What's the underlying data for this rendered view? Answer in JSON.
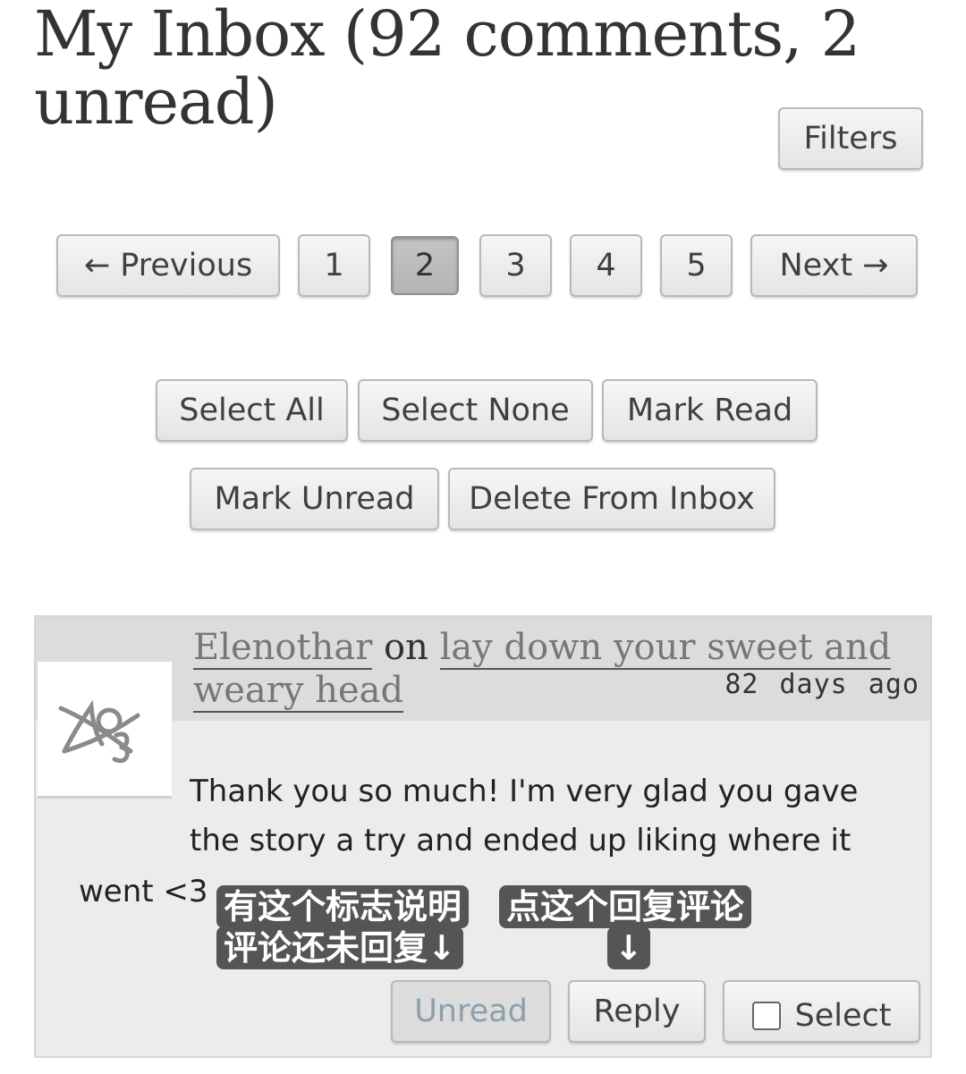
{
  "page_title": "My Inbox (92 comments, 2 unread)",
  "filters_label": "Filters",
  "pagination": {
    "previous": "← Previous",
    "pages": [
      "1",
      "2",
      "3",
      "4",
      "5"
    ],
    "current": "2",
    "next": "Next →"
  },
  "bulk_actions": {
    "select_all": "Select All",
    "select_none": "Select None",
    "mark_read": "Mark Read",
    "mark_unread": "Mark Unread",
    "delete_from_inbox": "Delete From Inbox"
  },
  "comment": {
    "author": "Elenothar",
    "on_word": "on",
    "work_title": "lay down your sweet and weary head",
    "time": "82 days ago",
    "avatar_icon": "ao3-logo-icon",
    "body_line": "Thank you so much! I'm very glad you gave the story a try and ended up liking where it",
    "body_tail": "went <3",
    "annotation_1_line1": "有这个标志说明",
    "annotation_1_line2": "评论还未回复↓",
    "annotation_2_line1": "点这个回复评论",
    "annotation_2_line2": "↓",
    "unread_label": "Unread",
    "reply_label": "Reply",
    "select_label": "Select"
  }
}
